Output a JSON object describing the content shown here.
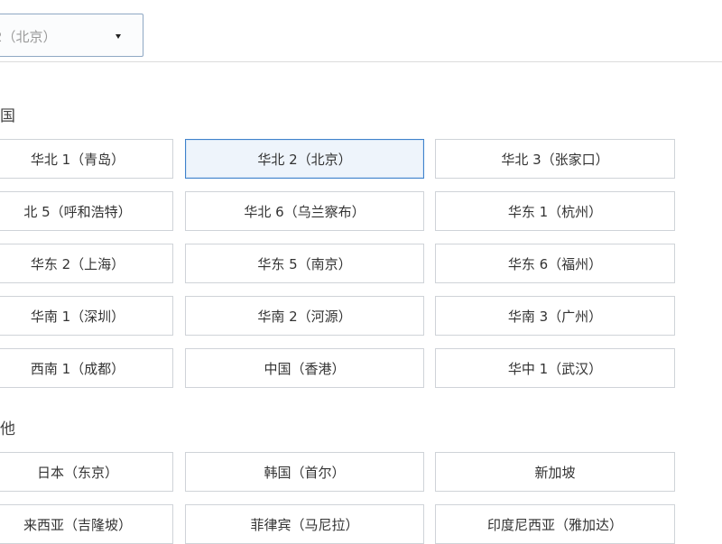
{
  "dropdown": {
    "value": "2（北京）"
  },
  "sections": [
    {
      "heading": "国",
      "options": [
        [
          "华北 1（青岛）",
          "华北 2（北京）",
          "华北 3（张家口）"
        ],
        [
          "北 5（呼和浩特）",
          "华北 6（乌兰察布）",
          "华东 1（杭州）"
        ],
        [
          "华东 2（上海）",
          "华东 5（南京）",
          "华东 6（福州）"
        ],
        [
          "华南 1（深圳）",
          "华南 2（河源）",
          "华南 3（广州）"
        ],
        [
          "西南 1（成都）",
          "中国（香港）",
          "华中 1（武汉）"
        ]
      ]
    },
    {
      "heading": "他",
      "options": [
        [
          "日本（东京）",
          "韩国（首尔）",
          "新加坡"
        ],
        [
          "来西亚（吉隆坡）",
          "菲律宾（马尼拉）",
          "印度尼西亚（雅加达）"
        ]
      ]
    }
  ],
  "selected": "华北 2（北京）"
}
